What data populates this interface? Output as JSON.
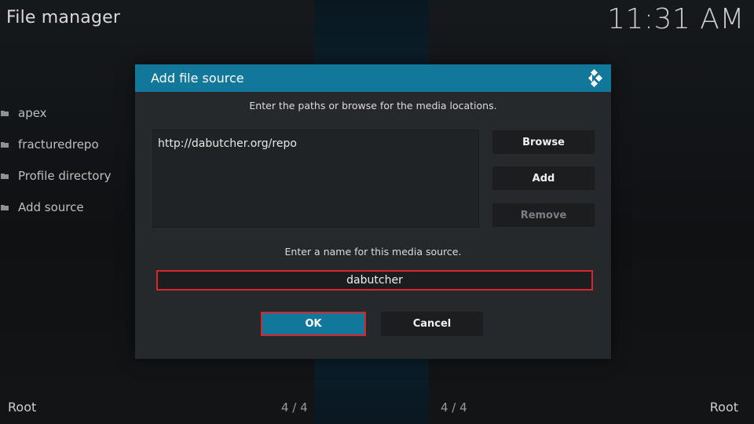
{
  "header": {
    "title": "File manager",
    "clock": "11:31 AM"
  },
  "sidebar": {
    "items": [
      {
        "label": "apex",
        "icon": "folder-icon"
      },
      {
        "label": "fracturedrepo",
        "icon": "folder-icon"
      },
      {
        "label": "Profile directory",
        "icon": "folder-icon"
      },
      {
        "label": "Add source",
        "icon": "folder-icon"
      }
    ]
  },
  "footer": {
    "left_label": "Root",
    "right_label": "Root",
    "left_count": "4 / 4",
    "right_count": "4 / 4"
  },
  "dialog": {
    "title": "Add file source",
    "icon": "kodi-logo-icon",
    "paths_instruction": "Enter the paths or browse for the media locations.",
    "paths": [
      "http://dabutcher.org/repo"
    ],
    "browse_label": "Browse",
    "add_label": "Add",
    "remove_label": "Remove",
    "name_instruction": "Enter a name for this media source.",
    "name_value": "dabutcher",
    "ok_label": "OK",
    "cancel_label": "Cancel"
  },
  "colors": {
    "accent": "#12789b",
    "focus_border": "#d9262c",
    "dialog_bg": "#26292c",
    "button_bg": "#1b1d1f"
  }
}
